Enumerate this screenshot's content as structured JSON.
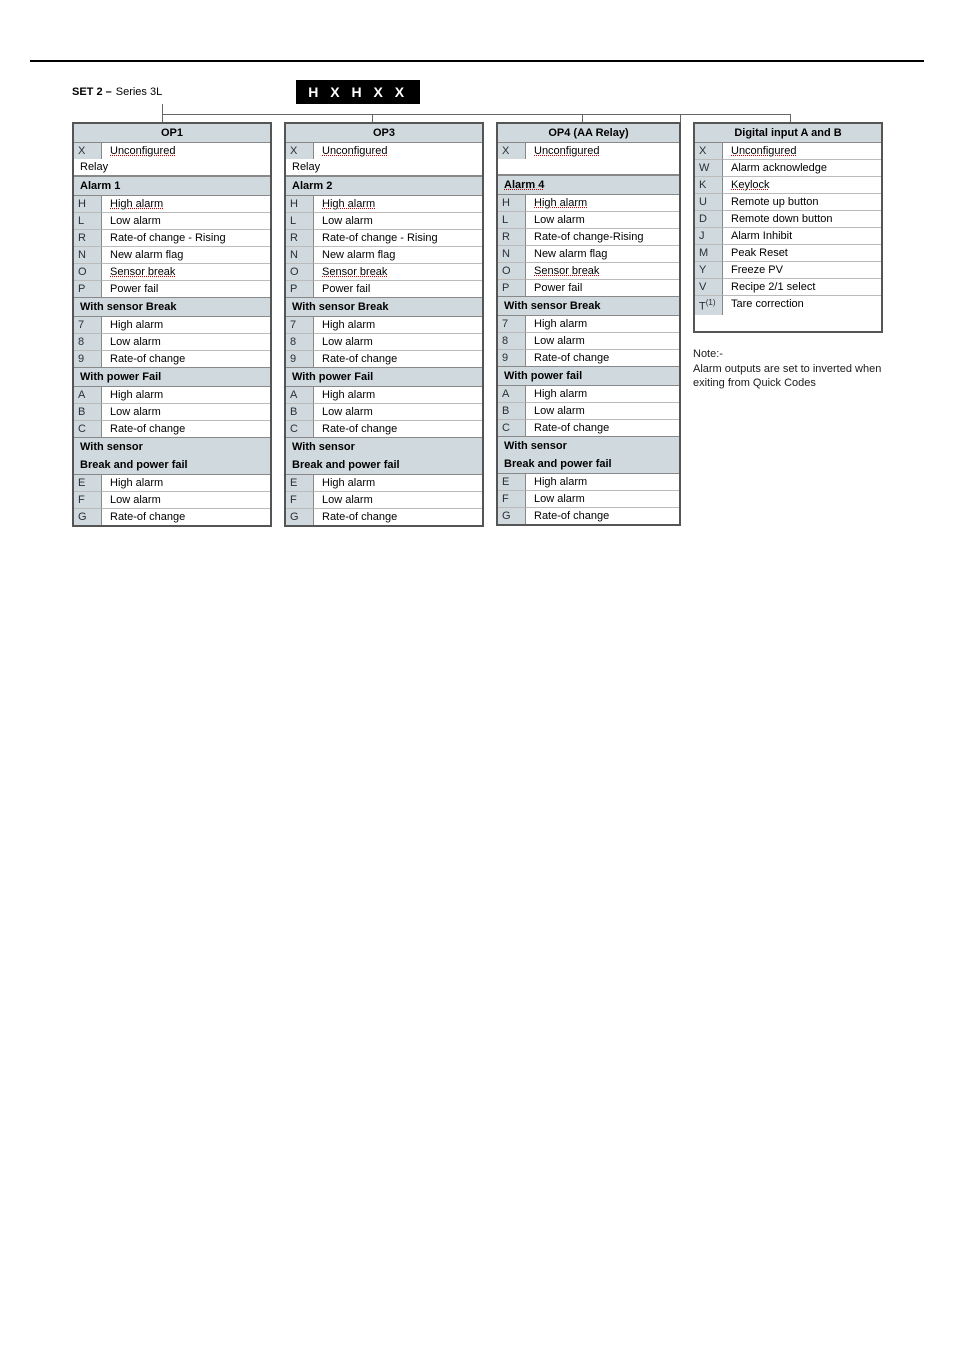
{
  "heading": {
    "set_bold": "SET 2 –",
    "series": " Series 3L",
    "black_label": "H X H X X"
  },
  "note": {
    "l1": "Note:-",
    "l2": "Alarm outputs are set to inverted when exiting from Quick Codes"
  },
  "tables": {
    "op1": {
      "title": "OP1",
      "unconf": [
        "X",
        "Unconfigured"
      ],
      "relay": "Relay",
      "alarm": "Alarm 1",
      "rows": [
        [
          "H",
          "High alarm"
        ],
        [
          "L",
          "Low alarm"
        ],
        [
          "R",
          "Rate-of change - Rising"
        ],
        [
          "N",
          "New alarm flag"
        ],
        [
          "O",
          "Sensor break"
        ],
        [
          "P",
          "Power fail"
        ]
      ],
      "sb_hdr": "With sensor Break",
      "sb": [
        [
          "7",
          "High alarm"
        ],
        [
          "8",
          "Low alarm"
        ],
        [
          "9",
          "Rate-of change"
        ]
      ],
      "pf_hdr": "With power Fail",
      "pf": [
        [
          "A",
          "High alarm"
        ],
        [
          "B",
          "Low alarm"
        ],
        [
          "C",
          "Rate-of change"
        ]
      ],
      "sbpf_hdr1": "With sensor",
      "sbpf_hdr2": "Break and power fail",
      "sbpf": [
        [
          "E",
          "High alarm"
        ],
        [
          "F",
          "Low alarm"
        ],
        [
          "G",
          "Rate-of change"
        ]
      ]
    },
    "op3": {
      "title": "OP3",
      "unconf": [
        "X",
        "Unconfigured"
      ],
      "relay": "Relay",
      "alarm": "Alarm  2",
      "rows": [
        [
          "H",
          "High alarm"
        ],
        [
          "L",
          "Low alarm"
        ],
        [
          "R",
          "Rate-of change - Rising"
        ],
        [
          "N",
          "New alarm flag"
        ],
        [
          "O",
          "Sensor break"
        ],
        [
          "P",
          "Power fail"
        ]
      ],
      "sb_hdr": "With sensor Break",
      "sb": [
        [
          "7",
          "High alarm"
        ],
        [
          "8",
          "Low alarm"
        ],
        [
          "9",
          "Rate-of change"
        ]
      ],
      "pf_hdr": "With power Fail",
      "pf": [
        [
          "A",
          "High alarm"
        ],
        [
          "B",
          "Low alarm"
        ],
        [
          "C",
          "Rate-of change"
        ]
      ],
      "sbpf_hdr1": "With sensor",
      "sbpf_hdr2": "Break and power fail",
      "sbpf": [
        [
          "E",
          "High alarm"
        ],
        [
          "F",
          "Low alarm"
        ],
        [
          "G",
          "Rate-of change"
        ]
      ]
    },
    "op4": {
      "title": "OP4 (AA Relay)",
      "unconf": [
        "X",
        "Unconfigured"
      ],
      "relay": "",
      "alarm": "Alarm 4",
      "rows": [
        [
          "H",
          "High alarm"
        ],
        [
          "L",
          "Low alarm"
        ],
        [
          "R",
          "Rate-of change-Rising"
        ],
        [
          "N",
          "New alarm flag"
        ],
        [
          "O",
          "Sensor break"
        ],
        [
          "P",
          "Power fail"
        ]
      ],
      "sb_hdr": "With sensor Break",
      "sb": [
        [
          "7",
          "High alarm"
        ],
        [
          "8",
          "Low alarm"
        ],
        [
          "9",
          "Rate-of change"
        ]
      ],
      "pf_hdr": "With power fail",
      "pf": [
        [
          "A",
          "High alarm"
        ],
        [
          "B",
          "Low alarm"
        ],
        [
          "C",
          "Rate-of change"
        ]
      ],
      "sbpf_hdr1": "With sensor",
      "sbpf_hdr2": "Break and power fail",
      "sbpf": [
        [
          "E",
          "High alarm"
        ],
        [
          "F",
          "Low alarm"
        ],
        [
          "G",
          "Rate-of change"
        ]
      ]
    },
    "dig": {
      "title": "Digital input A and B",
      "rows": [
        [
          "X",
          "Unconfigured"
        ],
        [
          "W",
          "Alarm acknowledge"
        ],
        [
          "K",
          "Keylock"
        ],
        [
          "U",
          "Remote up button"
        ],
        [
          "D",
          "Remote down button"
        ],
        [
          "J",
          "Alarm Inhibit"
        ],
        [
          "M",
          "Peak Reset"
        ],
        [
          "Y",
          "Freeze PV"
        ],
        [
          "V",
          "Recipe 2/1 select"
        ],
        [
          "T(1)",
          "Tare correction"
        ]
      ]
    }
  }
}
